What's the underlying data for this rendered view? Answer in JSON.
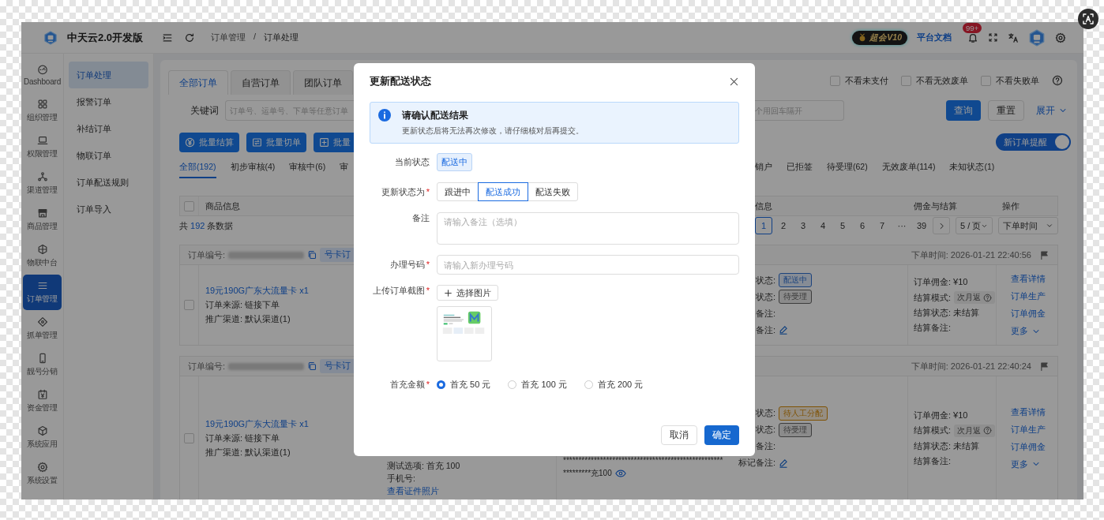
{
  "header": {
    "title": "中天云2.0开发版",
    "breadcrumb": [
      "订单管理",
      "订单处理"
    ],
    "breadcrumb_separator": "/",
    "vip_badge": "超会V10",
    "docs_link": "平台文档",
    "notification_count": "99+"
  },
  "rail": [
    {
      "label": "Dashboard",
      "selected": false
    },
    {
      "label": "组织管理",
      "selected": false
    },
    {
      "label": "权限管理",
      "selected": false
    },
    {
      "label": "渠道管理",
      "selected": false
    },
    {
      "label": "商品管理",
      "selected": false
    },
    {
      "label": "物联中台",
      "selected": false
    },
    {
      "label": "订单管理",
      "selected": true
    },
    {
      "label": "抓单管理",
      "selected": false
    },
    {
      "label": "靓号分销",
      "selected": false
    },
    {
      "label": "资金管理",
      "selected": false
    },
    {
      "label": "系统应用",
      "selected": false
    },
    {
      "label": "系统设置",
      "selected": false
    }
  ],
  "submenu": [
    {
      "label": "订单处理",
      "selected": true
    },
    {
      "label": "报警订单",
      "selected": false
    },
    {
      "label": "补结订单",
      "selected": false
    },
    {
      "label": "物联订单",
      "selected": false
    },
    {
      "label": "订单配送规则",
      "selected": false
    },
    {
      "label": "订单导入",
      "selected": false
    }
  ],
  "order_type_tabs": [
    {
      "label": "全部订单",
      "selected": true
    },
    {
      "label": "自营订单",
      "selected": false
    },
    {
      "label": "团队订单",
      "selected": false
    }
  ],
  "filters": [
    {
      "label": "不看未支付",
      "checked": false
    },
    {
      "label": "不看无效废单",
      "checked": false
    },
    {
      "label": "不看失败单",
      "checked": false
    }
  ],
  "keyword": {
    "label": "关键词",
    "placeholder": "订单号、运单号、下单等任意订单",
    "placeholder_continued": "个用回车隔开"
  },
  "search_buttons": {
    "query": "查询",
    "reset": "重置",
    "expand": "展开"
  },
  "bulk_actions": [
    "批量结算",
    "批量切单",
    "批量"
  ],
  "new_order_alert": {
    "label": "新订单提醒",
    "on": true
  },
  "status_tabs_left": [
    {
      "label": "全部(192)",
      "selected": true
    },
    {
      "label": "初步审核(4)",
      "selected": false
    },
    {
      "label": "审核中(6)",
      "selected": false
    },
    {
      "label": "审",
      "selected": false
    }
  ],
  "status_tabs_right": [
    {
      "label": "销户",
      "selected": false
    },
    {
      "label": "已拒签",
      "selected": false
    },
    {
      "label": "待受理(62)",
      "selected": false
    },
    {
      "label": "无效废单(114)",
      "selected": false
    },
    {
      "label": "未知状态(1)",
      "selected": false
    }
  ],
  "table_header": {
    "checked": false,
    "columns": [
      "商品信息",
      "信息",
      "佣金与结算",
      "操作"
    ]
  },
  "total": {
    "prefix": "共",
    "count": "192",
    "suffix": "条数据"
  },
  "pagination": {
    "pages": [
      {
        "label": "1",
        "selected": true
      },
      {
        "label": "2",
        "selected": false
      },
      {
        "label": "3",
        "selected": false
      },
      {
        "label": "4",
        "selected": false
      },
      {
        "label": "5",
        "selected": false
      },
      {
        "label": "6",
        "selected": false
      },
      {
        "label": "7",
        "selected": false
      }
    ],
    "ellipsis": "···",
    "last": "39",
    "page_size": "5 / 页",
    "sort": "下单时间"
  },
  "orders": [
    {
      "number_label": "订单编号:",
      "tag": "号卡订",
      "time": "下单时间: 2026-01-21 22:40:56",
      "checked": false,
      "product": "19元190G广东大流量卡 x1",
      "source": "订单来源: 链接下单",
      "channel": "推广渠道: 默认渠道(1)",
      "statuses": [
        {
          "label": "状态:",
          "tag": "配送中",
          "color": "#1c437d",
          "editable": false
        },
        {
          "label": "状态:",
          "tag": "待受理",
          "color": "#3d3d3d",
          "editable": false
        },
        {
          "label": "备注:",
          "editable": false
        },
        {
          "label": "备注:",
          "editable": true
        }
      ],
      "commission": "订单佣金: ¥10",
      "settle_mode_label": "结算模式:",
      "settle_mode": "次月返",
      "settle_status": "结算状态: 未结算",
      "settle_note": "结算备注:",
      "actions": [
        "查看详情",
        "订单生产",
        "订单佣金"
      ],
      "more": "更多"
    },
    {
      "number_label": "订单编号:",
      "tag": "号卡订",
      "time": "下单时间: 2026-01-21 22:40:24",
      "checked": false,
      "product": "19元190G广东大流量卡 x1",
      "source": "订单来源: 链接下单",
      "channel": "推广渠道: 默认渠道(1)",
      "details": [
        {
          "text": "测试选项: 首充 100",
          "kind": "text"
        },
        {
          "text": "手机号:",
          "kind": "text"
        },
        {
          "text": "查看证件照片",
          "kind": "link"
        }
      ],
      "masked": [
        {
          "text": "****************************************************",
          "revealable": false
        },
        {
          "text": "*********充100",
          "revealable": true
        }
      ],
      "statuses": [
        {
          "label": "状态:",
          "tag": "待人工分配",
          "color": "#7f5204",
          "editable": false
        },
        {
          "label": "状态:",
          "tag": "待受理",
          "color": "#3d3d3d",
          "editable": false
        },
        {
          "label": "备注:",
          "editable": false
        },
        {
          "label": "标记备注:",
          "editable": true
        }
      ],
      "commission": "订单佣金: ¥10",
      "settle_mode_label": "结算模式:",
      "settle_mode": "次月返",
      "settle_status": "结算状态: 未结算",
      "settle_note": "结算备注:",
      "actions": [
        "查看详情",
        "订单生产",
        "订单佣金"
      ],
      "more": "更多"
    }
  ],
  "dialog": {
    "title": "更新配送状态",
    "alert": {
      "title": "请确认配送结果",
      "message": "更新状态后将无法再次修改，请仔细核对后再提交。"
    },
    "required_mark": "*",
    "fields": [
      {
        "kind": "status",
        "label": "当前状态",
        "required": false,
        "value": "配送中"
      },
      {
        "kind": "segmented",
        "label": "更新状态为",
        "required": true,
        "options": [
          {
            "label": "跟进中",
            "selected": false
          },
          {
            "label": "配送成功",
            "selected": true
          },
          {
            "label": "配送失败",
            "selected": false
          }
        ]
      },
      {
        "kind": "textarea",
        "label": "备注",
        "required": false,
        "placeholder": "请输入备注（选填）"
      },
      {
        "kind": "input",
        "label": "办理号码",
        "required": true,
        "placeholder": "请输入新办理号码"
      },
      {
        "kind": "upload",
        "label": "上传订单截图",
        "required": true,
        "button": "选择图片"
      },
      {
        "kind": "radio",
        "label": "首充金额",
        "required": true,
        "options": [
          {
            "label": "首充 50 元",
            "selected": true
          },
          {
            "label": "首充 100 元",
            "selected": false
          },
          {
            "label": "首充 200 元",
            "selected": false
          }
        ]
      }
    ],
    "cancel": "取消",
    "confirm": "确定"
  }
}
